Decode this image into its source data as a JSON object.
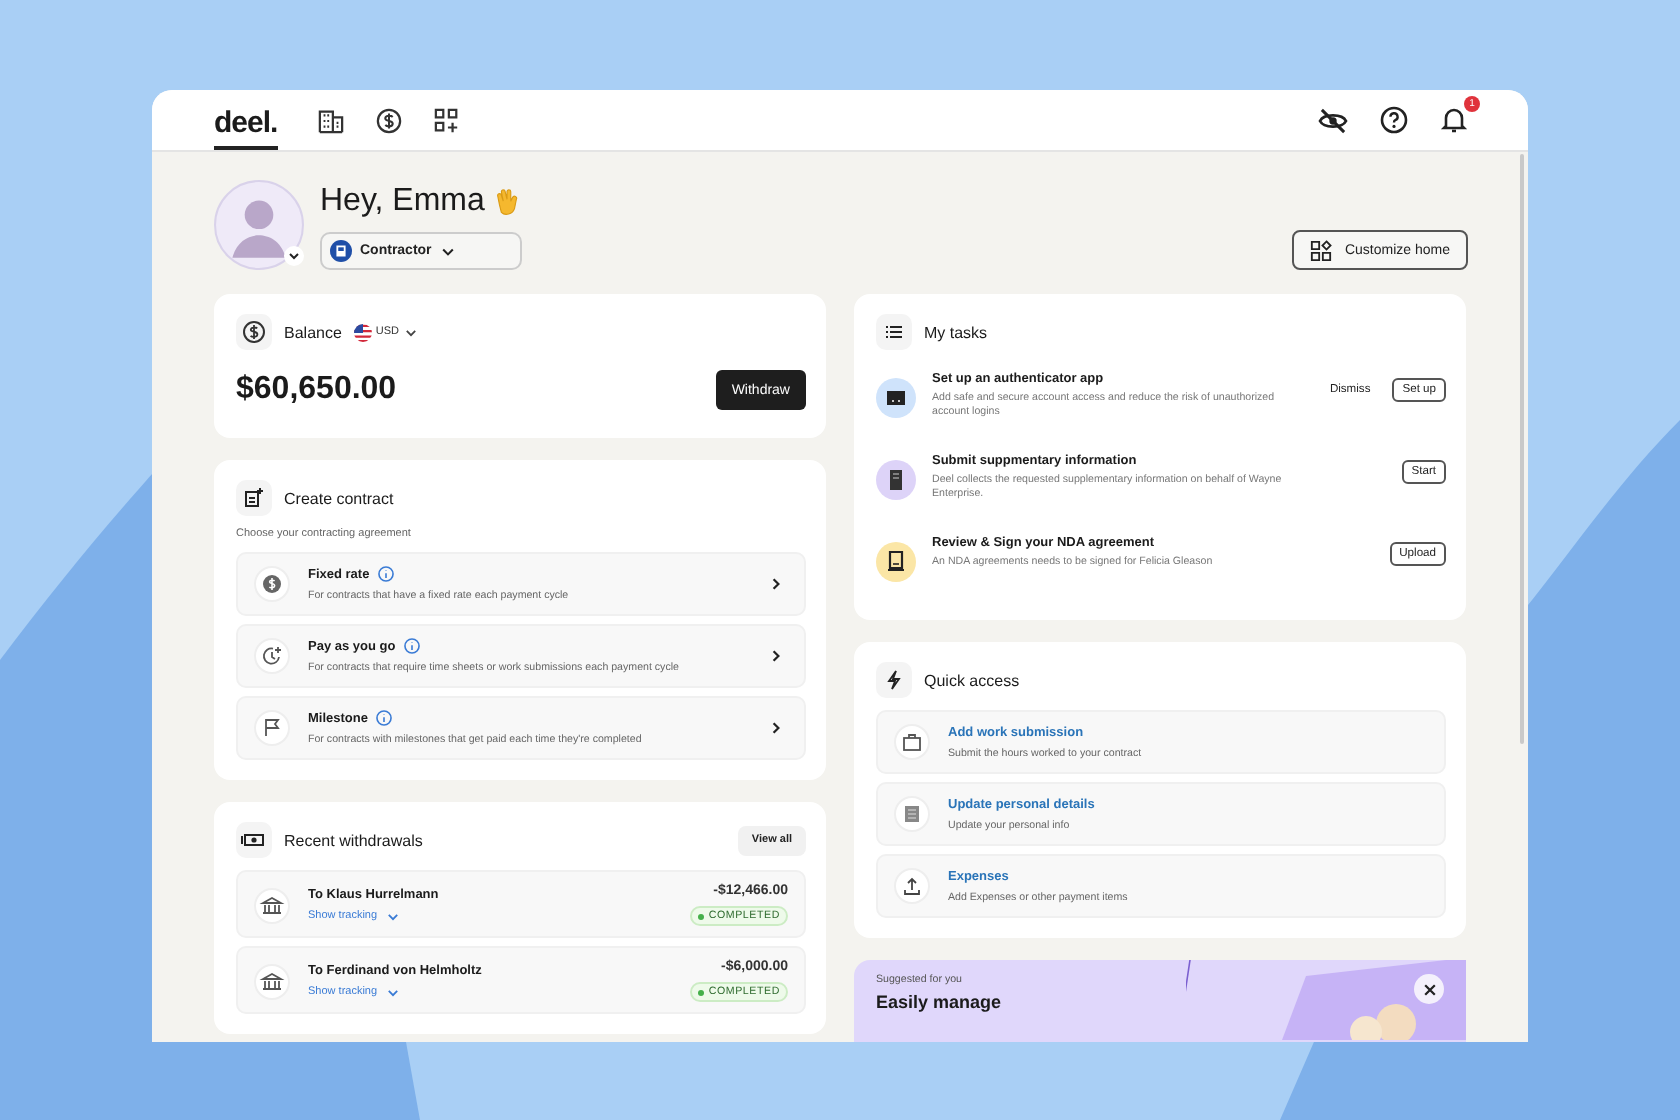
{
  "nav": {
    "logo": "deel.",
    "notification_count": "1"
  },
  "header": {
    "greeting": "Hey, Emma",
    "role": "Contractor",
    "customize_button": "Customize home"
  },
  "balance": {
    "title": "Balance",
    "currency": "USD",
    "amount": "$60,650.00",
    "button": "Withdraw"
  },
  "create_contract": {
    "title": "Create contract",
    "subtitle": "Choose your contracting agreement",
    "options": [
      {
        "title": "Fixed rate",
        "description": "For contracts that have a fixed rate each payment cycle"
      },
      {
        "title": "Pay as you go",
        "description": "For contracts that require time sheets or work submissions each payment cycle"
      },
      {
        "title": "Milestone",
        "description": "For contracts with milestones that get paid each time they're completed"
      }
    ]
  },
  "withdrawals": {
    "title": "Recent withdrawals",
    "view_all": "View all",
    "items": [
      {
        "recipient": "To Klaus Hurrelmann",
        "tracking": "Show tracking",
        "amount": "-$12,466.00",
        "status": "COMPLETED"
      },
      {
        "recipient": "To Ferdinand von Helmholtz",
        "tracking": "Show tracking",
        "amount": "-$6,000.00",
        "status": "COMPLETED"
      }
    ]
  },
  "tasks": {
    "title": "My tasks",
    "items": [
      {
        "title": "Set up an authenticator app",
        "description": "Add safe and secure account access and reduce the risk of unauthorized account logins",
        "color": "#cfe3fb",
        "actions": [
          {
            "label": "Dismiss",
            "kind": "text"
          },
          {
            "label": "Set up",
            "kind": "outline"
          }
        ]
      },
      {
        "title": "Submit suppmentary information",
        "description": "Deel collects the requested supplementary information on behalf of Wayne Enterprise.",
        "color": "#ddd3f8",
        "actions": [
          {
            "label": "Start",
            "kind": "outline"
          }
        ]
      },
      {
        "title": "Review & Sign your NDA agreement",
        "description": "An NDA agreements needs to be signed for Felicia Gleason",
        "color": "#fbe6a6",
        "actions": [
          {
            "label": "Upload",
            "kind": "outline"
          }
        ]
      }
    ]
  },
  "quick_access": {
    "title": "Quick access",
    "items": [
      {
        "title": "Add work submission",
        "description": "Submit the hours worked to your contract"
      },
      {
        "title": "Update personal details",
        "description": "Update your personal info"
      },
      {
        "title": "Expenses",
        "description": "Add Expenses or other payment items"
      }
    ]
  },
  "suggestion": {
    "label": "Suggested for you",
    "title": "Easily manage"
  }
}
